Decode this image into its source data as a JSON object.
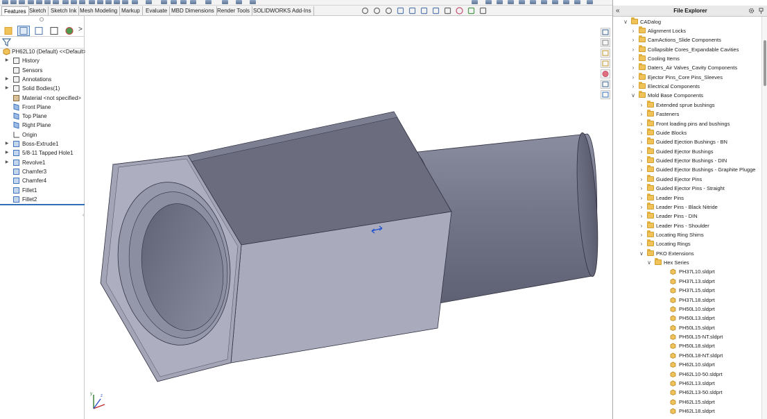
{
  "colors": {
    "accent": "#2f6db5",
    "hex_front": "#a7a9ba",
    "hex_top": "#6b6d7f",
    "cylinder": "#74768a",
    "folder": "#f0c35a"
  },
  "command_manager": {
    "tabs": [
      {
        "label": "Features",
        "active": true
      },
      {
        "label": "Sketch"
      },
      {
        "label": "Sketch Ink"
      },
      {
        "label": "Mesh Modeling"
      },
      {
        "label": "Markup"
      },
      {
        "label": "Evaluate"
      },
      {
        "label": "MBD Dimensions"
      },
      {
        "label": "Render Tools"
      },
      {
        "label": "SOLIDWORKS Add-Ins"
      }
    ]
  },
  "heads_up_toolbar": {
    "icons": [
      "zoom-to-fit-icon",
      "zoom-area-icon",
      "previous-view-icon",
      "section-view-icon",
      "dynamic-annotation-icon",
      "view-orientation-icon",
      "display-style-icon",
      "hide-show-icon",
      "edit-appearance-icon",
      "apply-scene-icon",
      "view-settings-icon"
    ]
  },
  "feature_manager": {
    "tab_icons": [
      "feature-manager-icon",
      "property-manager-icon",
      "configuration-manager-icon",
      "dimxpert-icon",
      "display-manager-icon"
    ],
    "more_tabs": ">",
    "root": "PH62L10 (Default) <<Default>_",
    "items": [
      {
        "label": "History",
        "icon": "history-icon",
        "expandable": true
      },
      {
        "label": "Sensors",
        "icon": "sensor-icon",
        "expandable": false
      },
      {
        "label": "Annotations",
        "icon": "annotation-icon",
        "expandable": true
      },
      {
        "label": "Solid Bodies(1)",
        "icon": "solid-bodies-icon",
        "expandable": true
      },
      {
        "label": "Material <not specified>",
        "icon": "material-icon",
        "expandable": false
      },
      {
        "label": "Front Plane",
        "icon": "plane-icon",
        "expandable": false
      },
      {
        "label": "Top Plane",
        "icon": "plane-icon",
        "expandable": false
      },
      {
        "label": "Right Plane",
        "icon": "plane-icon",
        "expandable": false
      },
      {
        "label": "Origin",
        "icon": "origin-icon",
        "expandable": false
      },
      {
        "label": "Boss-Extrude1",
        "icon": "extrude-icon",
        "expandable": true
      },
      {
        "label": "5/8-11 Tapped Hole1",
        "icon": "hole-icon",
        "expandable": true
      },
      {
        "label": "Revolve1",
        "icon": "revolve-icon",
        "expandable": true
      },
      {
        "label": "Chamfer3",
        "icon": "chamfer-icon",
        "expandable": false
      },
      {
        "label": "Chamfer4",
        "icon": "chamfer-icon",
        "expandable": false
      },
      {
        "label": "Fillet1",
        "icon": "fillet-icon",
        "expandable": false
      },
      {
        "label": "Fillet2",
        "icon": "fillet-icon",
        "expandable": false
      }
    ]
  },
  "task_pane": {
    "icons": [
      "solidworks-resources-icon",
      "design-library-icon",
      "file-explorer-icon",
      "view-palette-icon",
      "appearances-icon",
      "custom-properties-icon",
      "solidworks-forum-icon"
    ]
  },
  "file_explorer": {
    "title": "File Explorer",
    "back": "«",
    "rows": [
      {
        "label": "CADalog",
        "kind": "folder",
        "level": 0,
        "expanded": true
      },
      {
        "label": "Alignment Locks",
        "kind": "folder",
        "level": 1
      },
      {
        "label": "CamActions_Slide Components",
        "kind": "folder",
        "level": 1
      },
      {
        "label": "Collapsible Cores_Expandable Cavities",
        "kind": "folder",
        "level": 1
      },
      {
        "label": "Cooling Items",
        "kind": "folder",
        "level": 1
      },
      {
        "label": "Daters_Air Valves_Cavity Components",
        "kind": "folder",
        "level": 1
      },
      {
        "label": "Ejector Pins_Core Pins_Sleeves",
        "kind": "folder",
        "level": 1
      },
      {
        "label": "Electrical Components",
        "kind": "folder",
        "level": 1
      },
      {
        "label": "Mold Base Components",
        "kind": "folder",
        "level": 1,
        "expanded": true
      },
      {
        "label": "Extended sprue bushings",
        "kind": "folder",
        "level": 2
      },
      {
        "label": "Fasteners",
        "kind": "folder",
        "level": 2
      },
      {
        "label": "Front loading pins and bushings",
        "kind": "folder",
        "level": 2
      },
      {
        "label": "Guide Blocks",
        "kind": "folder",
        "level": 2
      },
      {
        "label": "Guided Ejection Bushings - BN",
        "kind": "folder",
        "level": 2
      },
      {
        "label": "Guided Ejector Bushings",
        "kind": "folder",
        "level": 2
      },
      {
        "label": "Guided Ejector Bushings - DIN",
        "kind": "folder",
        "level": 2
      },
      {
        "label": "Guided Ejector Bushings - Graphite Plugge",
        "kind": "folder",
        "level": 2
      },
      {
        "label": "Guided Ejector Pins",
        "kind": "folder",
        "level": 2
      },
      {
        "label": "Guided Ejector Pins - Straight",
        "kind": "folder",
        "level": 2
      },
      {
        "label": "Leader Pins",
        "kind": "folder",
        "level": 2
      },
      {
        "label": "Leader Pins - Black Nitride",
        "kind": "folder",
        "level": 2
      },
      {
        "label": "Leader Pins - DIN",
        "kind": "folder",
        "level": 2
      },
      {
        "label": "Leader Pins - Shoulder",
        "kind": "folder",
        "level": 2
      },
      {
        "label": "Locating Ring Shims",
        "kind": "folder",
        "level": 2
      },
      {
        "label": "Locating Rings",
        "kind": "folder",
        "level": 2
      },
      {
        "label": "PKO Extensions",
        "kind": "folder",
        "level": 2,
        "expanded": true
      },
      {
        "label": "Hex Series",
        "kind": "folder",
        "level": 3,
        "expanded": true
      },
      {
        "label": "PH37L10.sldprt",
        "kind": "part",
        "level": 4
      },
      {
        "label": "PH37L13.sldprt",
        "kind": "part",
        "level": 4
      },
      {
        "label": "PH37L15.sldprt",
        "kind": "part",
        "level": 4
      },
      {
        "label": "PH37L18.sldprt",
        "kind": "part",
        "level": 4
      },
      {
        "label": "PH50L10.sldprt",
        "kind": "part",
        "level": 4
      },
      {
        "label": "PH50L13.sldprt",
        "kind": "part",
        "level": 4
      },
      {
        "label": "PH50L15.sldprt",
        "kind": "part",
        "level": 4
      },
      {
        "label": "PH50L15-NT.sldprt",
        "kind": "part",
        "level": 4
      },
      {
        "label": "PH50L18.sldprt",
        "kind": "part",
        "level": 4
      },
      {
        "label": "PH50L18-NT.sldprt",
        "kind": "part",
        "level": 4
      },
      {
        "label": "PH62L10.sldprt",
        "kind": "part",
        "level": 4
      },
      {
        "label": "PH62L10-50.sldprt",
        "kind": "part",
        "level": 4
      },
      {
        "label": "PH62L13.sldprt",
        "kind": "part",
        "level": 4
      },
      {
        "label": "PH62L13-50.sldprt",
        "kind": "part",
        "level": 4
      },
      {
        "label": "PH62L15.sldprt",
        "kind": "part",
        "level": 4
      },
      {
        "label": "PH62L18.sldprt",
        "kind": "part",
        "level": 4
      }
    ]
  }
}
